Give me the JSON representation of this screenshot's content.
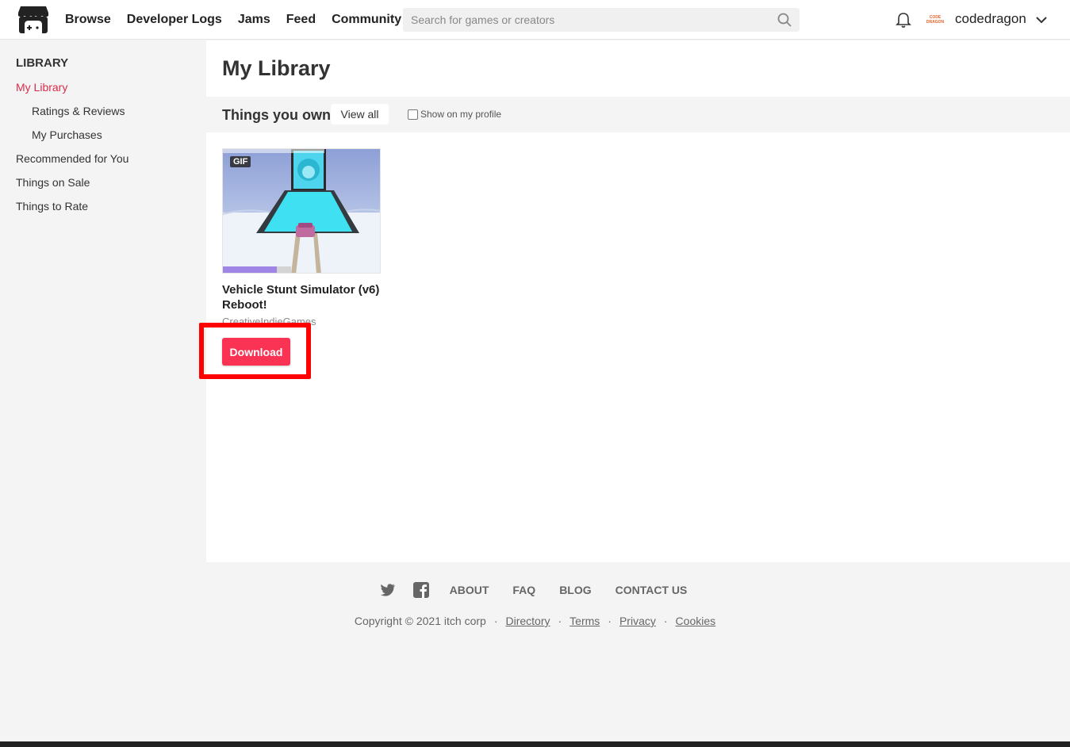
{
  "header": {
    "nav": [
      "Browse",
      "Developer Logs",
      "Jams",
      "Feed",
      "Community"
    ],
    "search_placeholder": "Search for games or creators",
    "avatar_text": [
      "CODE",
      "DRAGON"
    ],
    "username": "codedragon"
  },
  "sidebar": {
    "title": "LIBRARY",
    "items": [
      {
        "label": "My Library",
        "active": true
      },
      {
        "label": "Ratings & Reviews"
      },
      {
        "label": "My Purchases"
      },
      {
        "label": "Recommended for You"
      },
      {
        "label": "Things on Sale"
      },
      {
        "label": "Things to Rate"
      }
    ]
  },
  "main": {
    "title": "My Library",
    "section_title": "Things you own",
    "view_all": "View all",
    "show_profile_label": "Show on my profile",
    "show_profile_checked": false,
    "game": {
      "badge": "GIF",
      "title": "Vehicle Stunt Simulator (v6) Reboot!",
      "author": "CreativeIndieGames",
      "download_label": "Download"
    }
  },
  "footer": {
    "links": [
      "ABOUT",
      "FAQ",
      "BLOG",
      "CONTACT US"
    ],
    "copyright": "Copyright © 2021 itch corp",
    "legal_links": [
      "Directory",
      "Terms",
      "Privacy",
      "Cookies"
    ]
  },
  "colors": {
    "accent": "#fa3355",
    "active_link": "#da2c49",
    "highlight": "#ff0000"
  }
}
